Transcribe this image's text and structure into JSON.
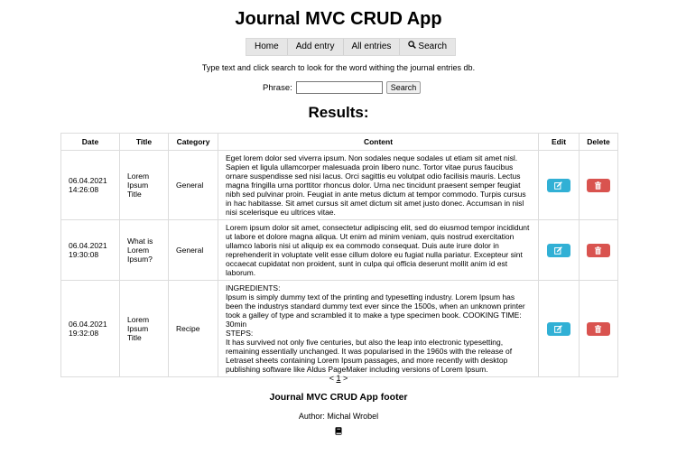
{
  "app_title": "Journal MVC CRUD App",
  "nav": {
    "home": "Home",
    "add_entry": "Add entry",
    "all_entries": "All entries",
    "search": "Search",
    "search_icon": "magnifier-icon"
  },
  "hint": "Type text and click search to look for the word withing the journal entries db.",
  "search": {
    "label": "Phrase:",
    "value": "",
    "button": "Search"
  },
  "results_title": "Results:",
  "table": {
    "headers": [
      "Date",
      "Title",
      "Category",
      "Content",
      "Edit",
      "Delete"
    ],
    "rows": [
      {
        "date": "06.04.2021\n14:26:08",
        "title": "Lorem\nIpsum\nTitle",
        "category": "General",
        "content": "Eget lorem dolor sed viverra ipsum. Non sodales neque sodales ut etiam sit amet nisl. Sapien et ligula ullamcorper malesuada proin libero nunc. Tortor vitae purus faucibus ornare suspendisse sed nisi lacus. Orci sagittis eu volutpat odio facilisis mauris. Lectus magna fringilla urna porttitor rhoncus dolor. Urna nec tincidunt praesent semper feugiat nibh sed pulvinar proin. Feugiat in ante metus dictum at tempor commodo. Turpis cursus in hac habitasse. Sit amet cursus sit amet dictum sit amet justo donec. Accumsan in nisl nisi scelerisque eu ultrices vitae."
      },
      {
        "date": "06.04.2021\n19:30:08",
        "title": "What is\nLorem\nIpsum?",
        "category": "General",
        "content": "Lorem ipsum dolor sit amet, consectetur adipiscing elit, sed do eiusmod tempor incididunt ut labore et dolore magna aliqua. Ut enim ad minim veniam, quis nostrud exercitation ullamco laboris nisi ut aliquip ex ea commodo consequat. Duis aute irure dolor in reprehenderit in voluptate velit esse cillum dolore eu fugiat nulla pariatur. Excepteur sint occaecat cupidatat non proident, sunt in culpa qui officia deserunt mollit anim id est laborum."
      },
      {
        "date": "06.04.2021\n19:32:08",
        "title": "Lorem\nIpsum\nTitle",
        "category": "Recipe",
        "content": "INGREDIENTS:\nIpsum is simply dummy text of the printing and typesetting industry. Lorem Ipsum has been the industrys standard dummy text ever since the 1500s, when an unknown printer took a galley of type and scrambled it to make a type specimen book. COOKING TIME: 30min\nSTEPS:\nIt has survived not only five centuries, but also the leap into electronic typesetting, remaining essentially unchanged. It was popularised in the 1960s with the release of Letraset sheets containing Lorem Ipsum passages, and more recently with desktop publishing software like Aldus PageMaker including versions of Lorem Ipsum."
      }
    ],
    "edit_icon": "edit-icon",
    "delete_icon": "trash-icon"
  },
  "pager": {
    "prev": "<",
    "page": "1",
    "next": ">"
  },
  "footer": {
    "title": "Journal MVC CRUD App footer",
    "author": "Author: Michal Wrobel",
    "icon": "book-icon"
  },
  "colors": {
    "edit_button": "#31b0d5",
    "delete_button": "#d9534f",
    "nav_background": "#e6e6e6"
  }
}
